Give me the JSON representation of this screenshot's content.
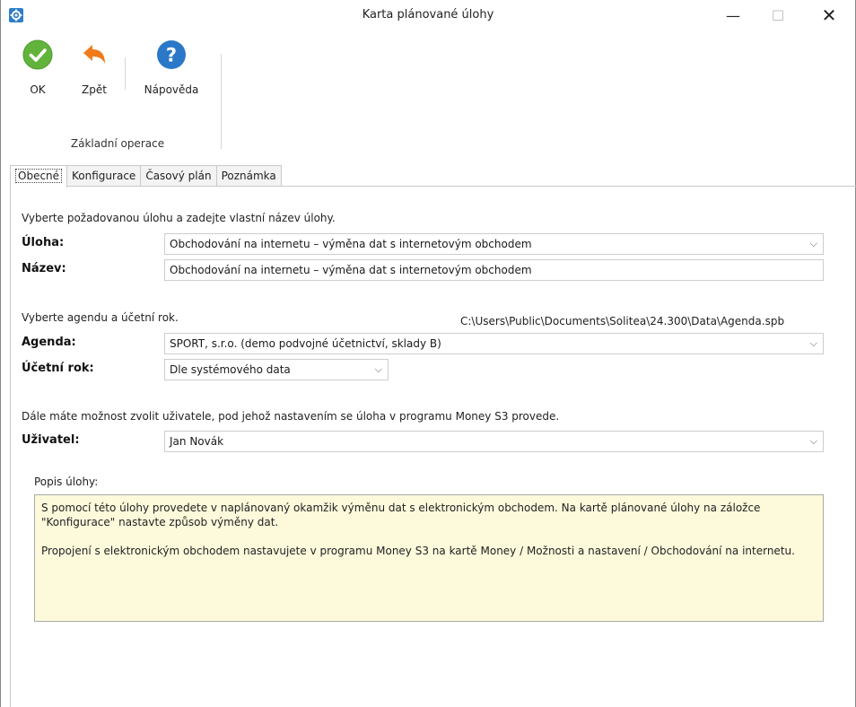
{
  "window": {
    "title": "Karta plánované úlohy",
    "minimize_glyph": "—",
    "maximize_glyph": "☐",
    "close_glyph": "✕"
  },
  "ribbon": {
    "ok_label": "OK",
    "back_label": "Zpět",
    "help_label": "Nápověda",
    "group_label": "Základní operace",
    "ok_color": "#62b33b",
    "back_color": "#f07a1a",
    "help_color": "#2b78c8"
  },
  "tabs": [
    "Obecné",
    "Konfigurace",
    "Časový plán",
    "Poznámka"
  ],
  "form": {
    "intro_task": "Vyberte požadovanou úlohu a zadejte vlastní název úlohy.",
    "task_label": "Úloha:",
    "task_value": "Obchodování na internetu – výměna dat s internetovým obchodem",
    "name_label": "Název:",
    "name_value": "Obchodování na internetu – výměna dat s internetovým obchodem",
    "intro_agenda": "Vyberte agendu a účetní rok.",
    "agenda_path": "C:\\Users\\Public\\Documents\\Solitea\\24.300\\Data\\Agenda.spb",
    "agenda_label": "Agenda:",
    "agenda_value": "SPORT, s.r.o. (demo podvojné účetnictví, sklady B)",
    "year_label": "Účetní rok:",
    "year_value": "Dle systémového data",
    "intro_user": "Dále máte možnost zvolit uživatele, pod jehož nastavením se úloha v programu Money S3 provede.",
    "user_label": "Uživatel:",
    "user_value": "Jan Novák",
    "desc_label": "Popis úlohy:",
    "desc_p1": "S pomocí této úlohy provedete v naplánovaný okamžik výměnu dat s elektronickým obchodem. Na kartě plánované úlohy na záložce \"Konfigurace\" nastavte způsob výměny dat.",
    "desc_p2": "Propojení s elektronickým obchodem nastavujete v programu Money S3 na kartě Money / Možnosti a nastavení / Obchodování na internetu."
  }
}
